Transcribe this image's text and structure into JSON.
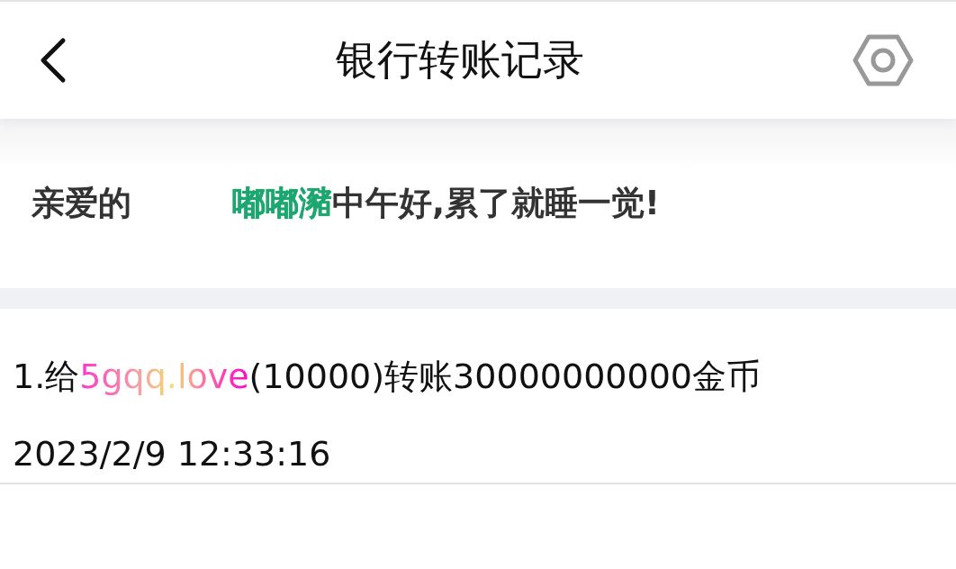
{
  "header": {
    "title": "银行转账记录"
  },
  "greeting": {
    "salutation": "亲爱的",
    "name": "嘟嘟瀦",
    "message": "中午好,累了就睡一觉!"
  },
  "records": [
    {
      "prefix": "1.给",
      "recipient": "5gqq.love",
      "detail": "(10000)转账30000000000金币",
      "time": "2023/2/9 12:33:16"
    }
  ]
}
